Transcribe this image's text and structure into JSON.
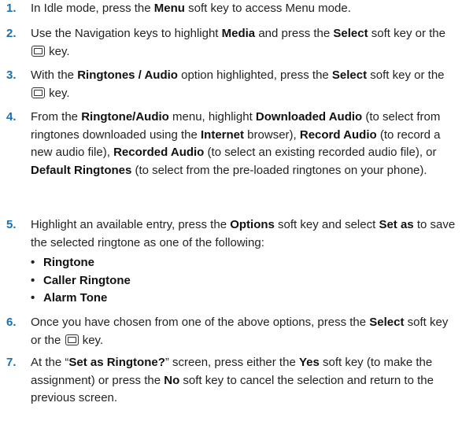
{
  "steps": [
    {
      "number": "1.",
      "parts": [
        "In Idle mode, press the ",
        "Menu",
        " soft key to access Menu mode."
      ]
    },
    {
      "number": "2.",
      "parts": [
        "Use the Navigation keys to highlight ",
        "Media",
        " and press the ",
        "Select",
        " soft key or the ",
        "",
        " key."
      ]
    },
    {
      "number": "3.",
      "parts": [
        "With the ",
        "Ringtones / Audio",
        " option highlighted, press the ",
        "Select",
        " soft key or the ",
        "",
        " key."
      ]
    },
    {
      "number": "4.",
      "parts": [
        "From the ",
        "Ringtone/Audio",
        " menu, highlight ",
        "Downloaded Audio",
        " (to select from ringtones downloaded using the ",
        "Internet",
        " browser), ",
        "Record Audio",
        " (to record a new audio file), ",
        "Recorded Audio",
        " (to select an existing recorded audio file), or ",
        "Default Ringtones",
        " (to select from the pre-loaded ringtones on your phone)."
      ]
    },
    {
      "number": "5.",
      "parts": [
        "Highlight an available entry, press the ",
        "Options",
        " soft key and select ",
        "Set as",
        " to save the selected ringtone as one of the following:"
      ]
    },
    {
      "number": "6.",
      "parts": [
        "Once you have chosen from one of the above options, press the ",
        "Select",
        " soft key or the ",
        "",
        " key."
      ]
    },
    {
      "number": "7.",
      "parts": [
        "At the “",
        "Set as Ringtone?",
        "” screen, press either the ",
        "Yes",
        " soft key (to make the assignment) or press the ",
        "No",
        " soft key to cancel the selection and return to the previous screen."
      ]
    }
  ],
  "step5_options": [
    "Ringtone",
    "Caller Ringtone",
    "Alarm Tone"
  ],
  "icons": {
    "bullet": "•",
    "select_key": "select-key-icon"
  }
}
